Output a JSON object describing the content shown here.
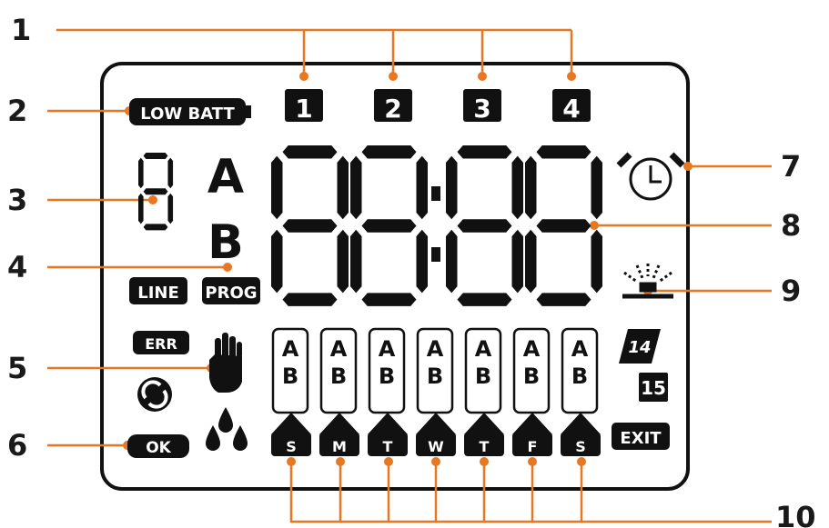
{
  "callouts": [
    "1",
    "2",
    "3",
    "4",
    "5",
    "6",
    "7",
    "8",
    "9",
    "10"
  ],
  "indicators": {
    "low_batt": "LOW BATT",
    "line": "LINE",
    "prog": "PROG",
    "err": "ERR",
    "ok": "OK",
    "exit": "EXIT"
  },
  "zones": [
    "1",
    "2",
    "3",
    "4"
  ],
  "program_letters": [
    "A",
    "B"
  ],
  "days": [
    {
      "a": "A",
      "b": "B",
      "letter": "S"
    },
    {
      "a": "A",
      "b": "B",
      "letter": "M"
    },
    {
      "a": "A",
      "b": "B",
      "letter": "T"
    },
    {
      "a": "A",
      "b": "B",
      "letter": "W"
    },
    {
      "a": "A",
      "b": "B",
      "letter": "T"
    },
    {
      "a": "A",
      "b": "B",
      "letter": "F"
    },
    {
      "a": "A",
      "b": "B",
      "letter": "S"
    }
  ],
  "interval": {
    "top": "14",
    "bottom": "15"
  },
  "colors": {
    "callout_line": "#e87722",
    "lcd_ink": "#111111",
    "frame": "#111111"
  },
  "icons": [
    "battery-icon",
    "alarm-clock-icon",
    "sprinkler-icon",
    "hand-icon",
    "water-drops-icon",
    "rotation-icon"
  ]
}
